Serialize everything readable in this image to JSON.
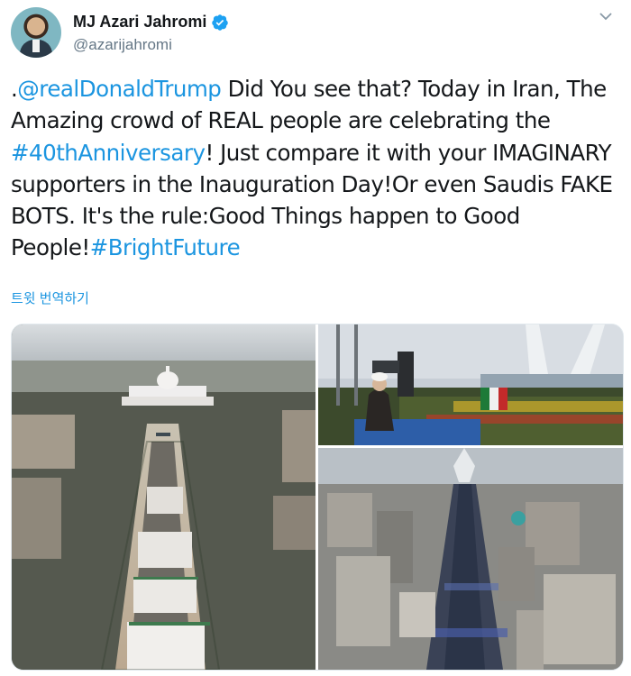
{
  "author": {
    "name": "MJ Azari Jahromi",
    "handle": "@azarijahromi",
    "verified": true,
    "avatar_icon": "profile-photo"
  },
  "tweet": {
    "mention": "@realDonaldTrump",
    "hashtag_1": "#40thAnniversary",
    "hashtag_2": "#BrightFuture",
    "segments": {
      "lead": ".",
      "s1": " Did You see that? Today in Iran, The Amazing crowd of REAL people are celebrating the ",
      "s2": "! Just compare it with your IMAGINARY supporters in the Inauguration Day!Or even Saudis FAKE BOTS. It's the rule:Good Things happen to Good People!"
    },
    "translate_label": "트윗 번역하기"
  },
  "media": {
    "count": 3,
    "images": [
      {
        "icon": "aerial-capitol-crowd-photo"
      },
      {
        "icon": "speaker-podium-rally-photo"
      },
      {
        "icon": "aerial-tehran-crowd-photo"
      }
    ]
  },
  "colors": {
    "link": "#1b95e0",
    "text": "#14171a",
    "secondary": "#657786",
    "verified": "#1da1f2"
  }
}
